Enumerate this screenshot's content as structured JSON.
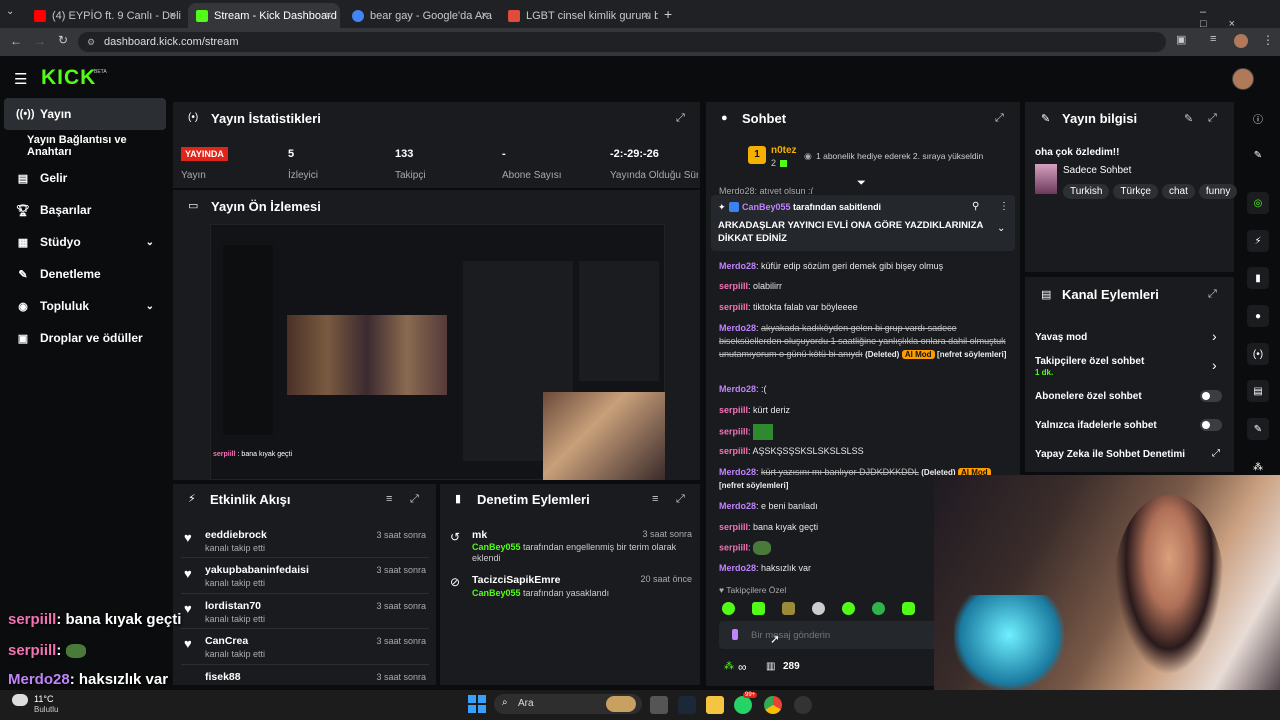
{
  "browser": {
    "tabs": [
      {
        "label": "(4) EYPİO ft. 9 Canlı - Deli dediler",
        "active": false,
        "favicon_color": "#ff0000"
      },
      {
        "label": "Stream - Kick Dashboard",
        "active": true,
        "favicon_color": "#53fc18"
      },
      {
        "label": "bear gay - Google'da Ara",
        "active": false,
        "favicon_color": "#4285f4"
      },
      {
        "label": "LGBT cinsel kimlik gururu bayrakları",
        "active": false,
        "favicon_color": "#e04b3c"
      }
    ],
    "url": "dashboard.kick.com/stream"
  },
  "header": {
    "logo": "KICK",
    "logo_badge": "BETA"
  },
  "sidebar": {
    "items": [
      {
        "label": "Yayın",
        "icon": "broadcast-icon",
        "active": true
      },
      {
        "label": "Yayın Bağlantısı ve Anahtarı",
        "icon": "",
        "active": false
      },
      {
        "label": "Gelir",
        "icon": "money-icon",
        "active": false
      },
      {
        "label": "Başarılar",
        "icon": "trophy-icon",
        "active": false
      },
      {
        "label": "Stüdyo",
        "icon": "studio-icon",
        "active": false,
        "chevron": true
      },
      {
        "label": "Denetleme",
        "icon": "wrench-icon",
        "active": false
      },
      {
        "label": "Topluluk",
        "icon": "community-icon",
        "active": false,
        "chevron": true
      },
      {
        "label": "Droplar ve ödüller",
        "icon": "gift-icon",
        "active": false
      }
    ]
  },
  "stats": {
    "title": "Yayın İstatistikleri",
    "live_badge": "YAYINDA",
    "live_label": "Yayın",
    "viewers": {
      "value": "5",
      "label": "İzleyici"
    },
    "followers": {
      "value": "133",
      "label": "Takipçi"
    },
    "subs": {
      "value": "-",
      "label": "Abone Sayısı"
    },
    "uptime": {
      "value": "-2:-29:-26",
      "label": "Yayında Olduğu Süre"
    }
  },
  "preview": {
    "title": "Yayın Ön İzlemesi",
    "chat_name": "serpiill",
    "chat_text": "bana kıyak geçti"
  },
  "activity": {
    "title": "Etkinlik Akışı",
    "items": [
      {
        "name": "eeddiebrock",
        "sub": "kanalı takip etti",
        "time": "3 saat sonra"
      },
      {
        "name": "yakupbabaninfedaisi",
        "sub": "kanalı takip etti",
        "time": "3 saat sonra"
      },
      {
        "name": "lordistan70",
        "sub": "kanalı takip etti",
        "time": "3 saat sonra"
      },
      {
        "name": "CanCrea",
        "sub": "kanalı takip etti",
        "time": "3 saat sonra"
      },
      {
        "name": "fisek88",
        "sub": "",
        "time": "3 saat sonra"
      }
    ]
  },
  "moderation": {
    "title": "Denetim Eylemleri",
    "items": [
      {
        "name": "mk",
        "actor": "CanBey055",
        "text": "tarafından engellenmiş bir terim olarak eklendi",
        "time": "3 saat sonra"
      },
      {
        "name": "TacizciSapikEmre",
        "actor": "CanBey055",
        "text": "tarafından yasaklandı",
        "time": "20 saat önce"
      }
    ]
  },
  "chat": {
    "title": "Sohbet",
    "gift": {
      "rank": "1",
      "user": "n0tez",
      "count": "2",
      "text": "1 abonelik hediye ederek 2. sıraya yükseldin"
    },
    "partial_top": "Merdo28: atıyet olsun :(",
    "pinned": {
      "by": "CanBey055",
      "by_suffix": "tarafından sabitlendi",
      "text": "ARKADAŞLAR YAYINCI EVLİ ONA GÖRE YAZDIKLARINIZA DİKKAT EDİNİZ"
    },
    "messages": [
      {
        "user": "Merdo28",
        "color": "u-purple",
        "text": "küfür edip sözüm geri demek gibi bişey olmuş"
      },
      {
        "user": "serpiill",
        "color": "u-pink",
        "text": "olabilirr"
      },
      {
        "user": "serpiill",
        "color": "u-pink",
        "text": "tiktokta falab var böyleeee"
      },
      {
        "user": "Merdo28",
        "color": "u-purple",
        "text": "akyakada kadıköyden gelen bi grup vardı sadece biseksüellerden oluşuyordu 1 saatliğine yanlışlıkla onlara dahil olmuştuk unutamıyorum o günü kötü bi anıydı",
        "deleted": true,
        "deleted_label": "(Deleted)",
        "mod": "AI Mod",
        "reason": "[nefret söylemleri]"
      },
      {
        "user": "Merdo28",
        "color": "u-purple",
        "text": ":("
      },
      {
        "user": "serpiill",
        "color": "u-pink",
        "text": "kürt deriz"
      },
      {
        "user": "serpiill",
        "color": "u-pink",
        "text": "",
        "emote": true
      },
      {
        "user": "serpiill",
        "color": "u-pink",
        "text": "AŞSKŞSŞSKSLSKSLSLSS"
      },
      {
        "user": "Merdo28",
        "color": "u-purple",
        "text": "kürt yazısını mı banlıyor DJDKDKKDDL",
        "deleted": true,
        "deleted_label": "(Deleted)",
        "mod": "AI Mod",
        "reason": "[nefret söylemleri]"
      },
      {
        "user": "Merdo28",
        "color": "u-purple",
        "text": "e beni banladı"
      },
      {
        "user": "serpiill",
        "color": "u-pink",
        "text": "bana kıyak geçti"
      },
      {
        "user": "serpiill",
        "color": "u-pink",
        "text": "",
        "emote": true
      },
      {
        "user": "Merdo28",
        "color": "u-purple",
        "text": "haksızlık var"
      }
    ],
    "followers_only": "Takipçilere Özel",
    "input_placeholder": "Bir mesaj gönderin",
    "footer_infinity": "∞",
    "footer_count": "289"
  },
  "stream_info": {
    "title": "Yayın bilgisi",
    "stream_title": "oha çok özledim!!",
    "category": "Sadece Sohbet",
    "tags": [
      "Turkish",
      "Türkçe",
      "chat",
      "funny"
    ]
  },
  "channel_actions": {
    "title": "Kanal Eylemleri",
    "slow_mode": "Yavaş mod",
    "followers_chat": "Takipçilere özel sohbet",
    "followers_chat_value": "1 dk.",
    "subs_chat": "Abonelere özel sohbet",
    "emote_chat": "Yalnızca ifadelerle sohbet",
    "ai_mod": "Yapay Zeka ile Sohbet Denetimi"
  },
  "overlay": {
    "lines": [
      {
        "user": "serpiill",
        "text": ": bana kıyak geçti"
      },
      {
        "user": "serpiill",
        "text": ":"
      },
      {
        "user": "Merdo28",
        "text": ": haksızlık var"
      }
    ]
  },
  "taskbar": {
    "weather_temp": "11°C",
    "weather_desc": "Bulutlu",
    "search": "Ara",
    "badge": "99+"
  }
}
